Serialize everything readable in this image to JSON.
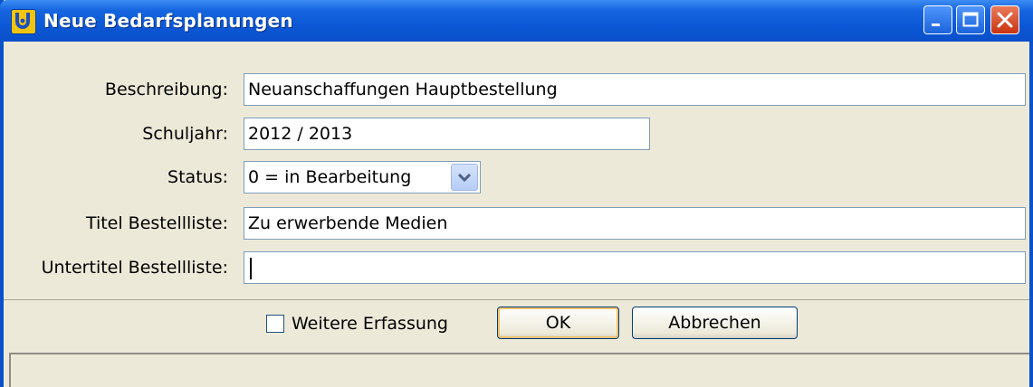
{
  "window": {
    "title": "Neue Bedarfsplanungen",
    "icon": "app-logo-icon",
    "controls": [
      "minimize-icon",
      "maximize-icon",
      "close-icon"
    ]
  },
  "form": {
    "beschreibung": {
      "label": "Beschreibung:",
      "value": "Neuanschaffungen Hauptbestellung"
    },
    "schuljahr": {
      "label": "Schuljahr:",
      "value": "2012 / 2013"
    },
    "status": {
      "label": "Status:",
      "value": "0 = in Bearbeitung"
    },
    "titel": {
      "label": "Titel Bestellliste:",
      "value": "Zu erwerbende Medien"
    },
    "untertitel": {
      "label": "Untertitel Bestellliste:",
      "value": ""
    }
  },
  "footer": {
    "checkbox_label": "Weitere Erfassung",
    "checkbox_checked": false,
    "ok_label": "OK",
    "cancel_label": "Abbrechen"
  },
  "colors": {
    "titlebar": "#0a52c9",
    "window_bg": "#ece9d8",
    "input_border": "#7f9db9"
  }
}
